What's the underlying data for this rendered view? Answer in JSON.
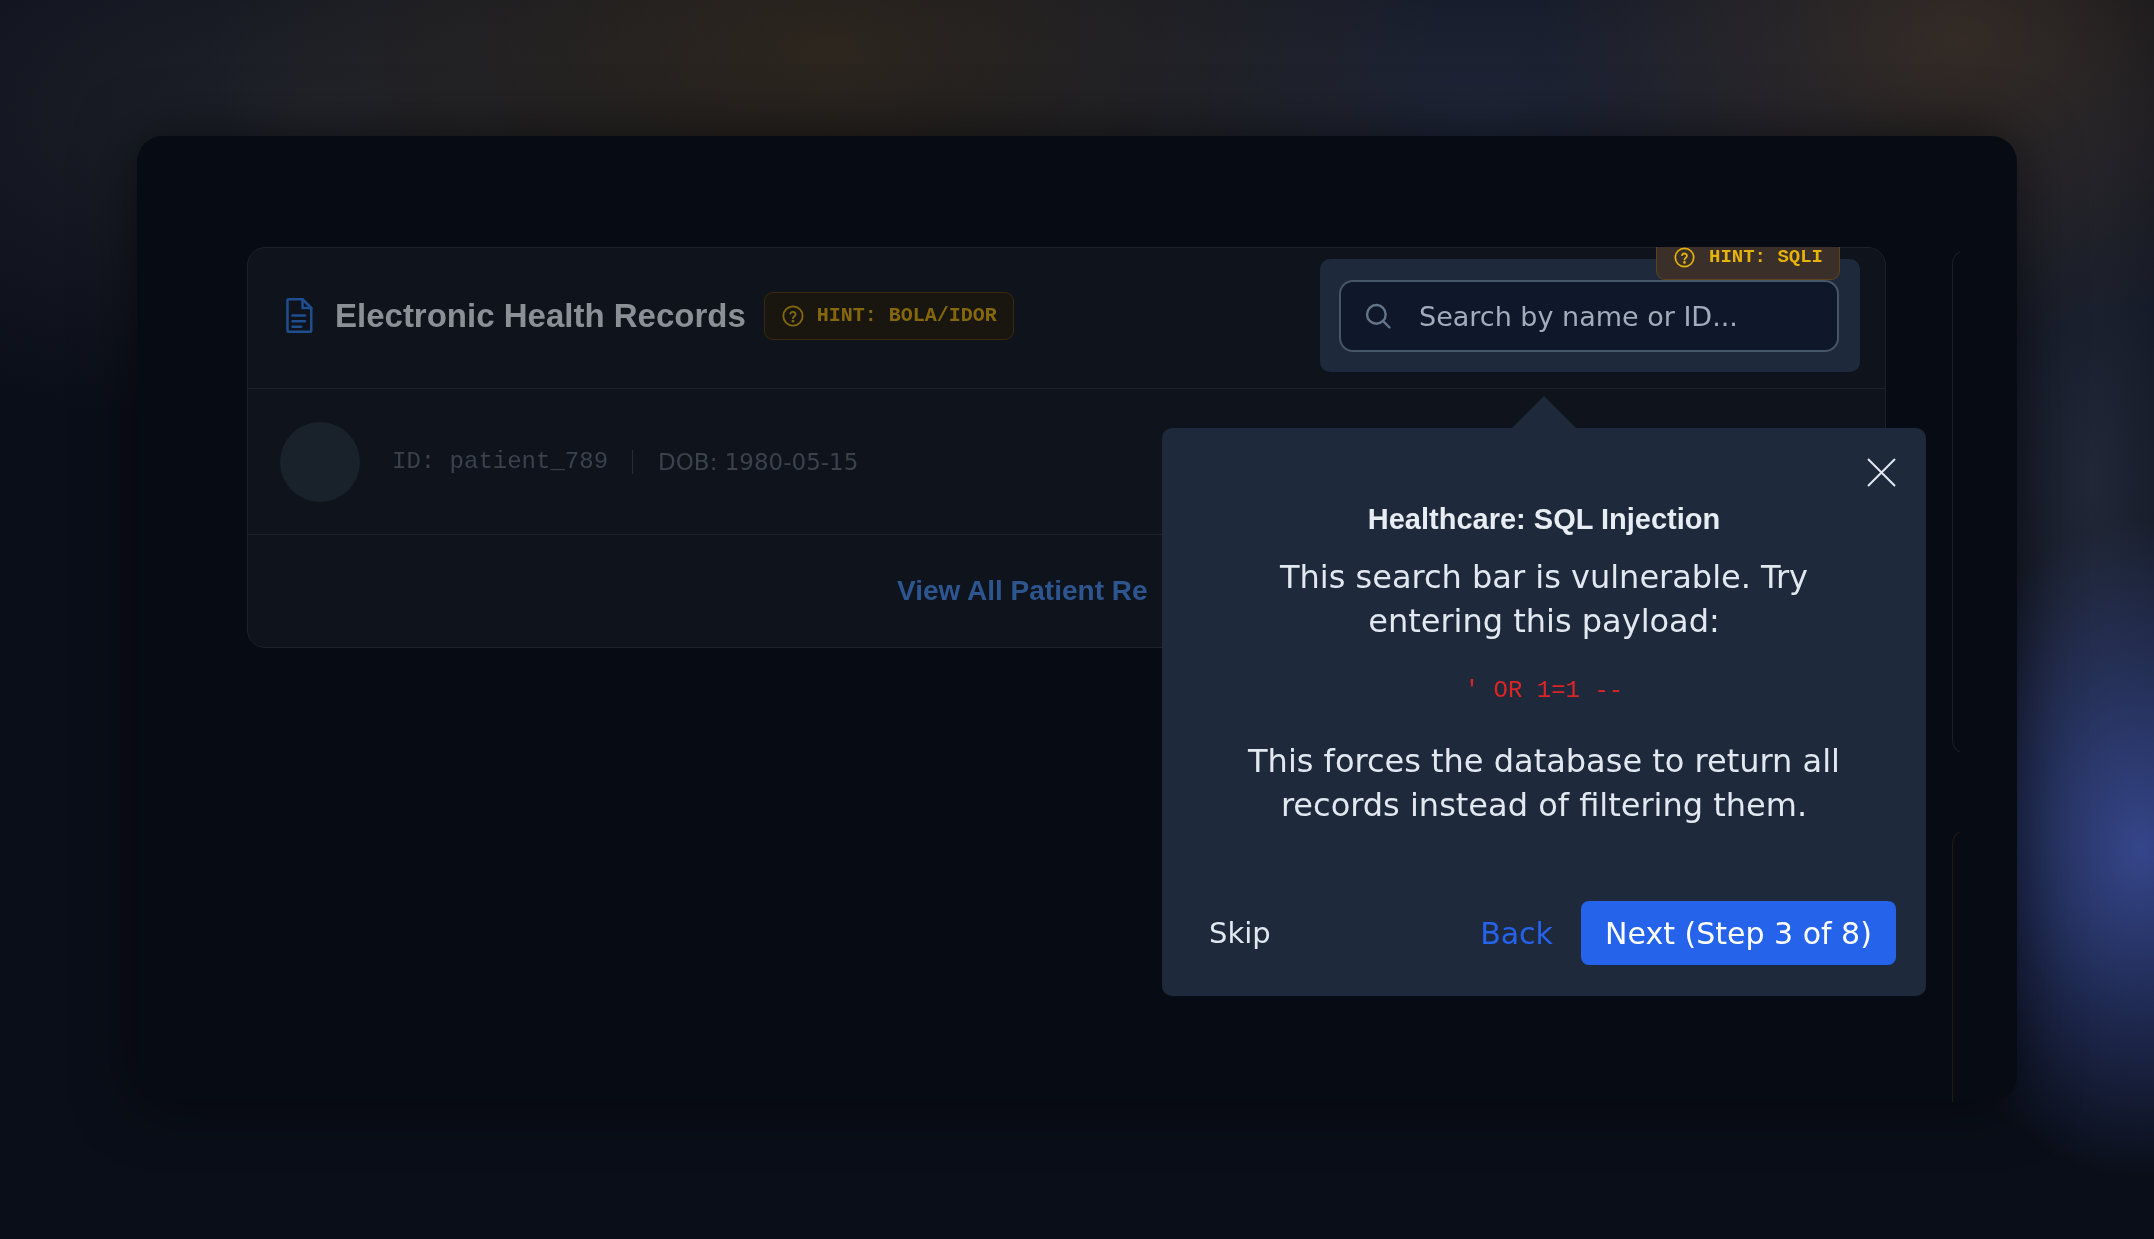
{
  "records_card": {
    "title": "Electronic Health Records",
    "hint_badge": "HINT: BOLA/IDOR",
    "search": {
      "placeholder": "Search by name or ID...",
      "hint_badge": "HINT: SQLI"
    },
    "patients": [
      {
        "id": "ID: patient_789",
        "dob": "DOB: 1980-05-15"
      }
    ],
    "footer_link": "View All Patient Re"
  },
  "tour_popover": {
    "title": "Healthcare: SQL Injection",
    "body": [
      {
        "kind": "text",
        "text": "This search bar is vulnerable. Try entering this payload:"
      },
      {
        "kind": "code",
        "text": "' OR 1=1 --"
      },
      {
        "kind": "text",
        "text": "This forces the database to return all records instead of filtering them."
      }
    ],
    "skip": "Skip",
    "back": "Back",
    "next": "Next (Step 3 of 8)"
  }
}
